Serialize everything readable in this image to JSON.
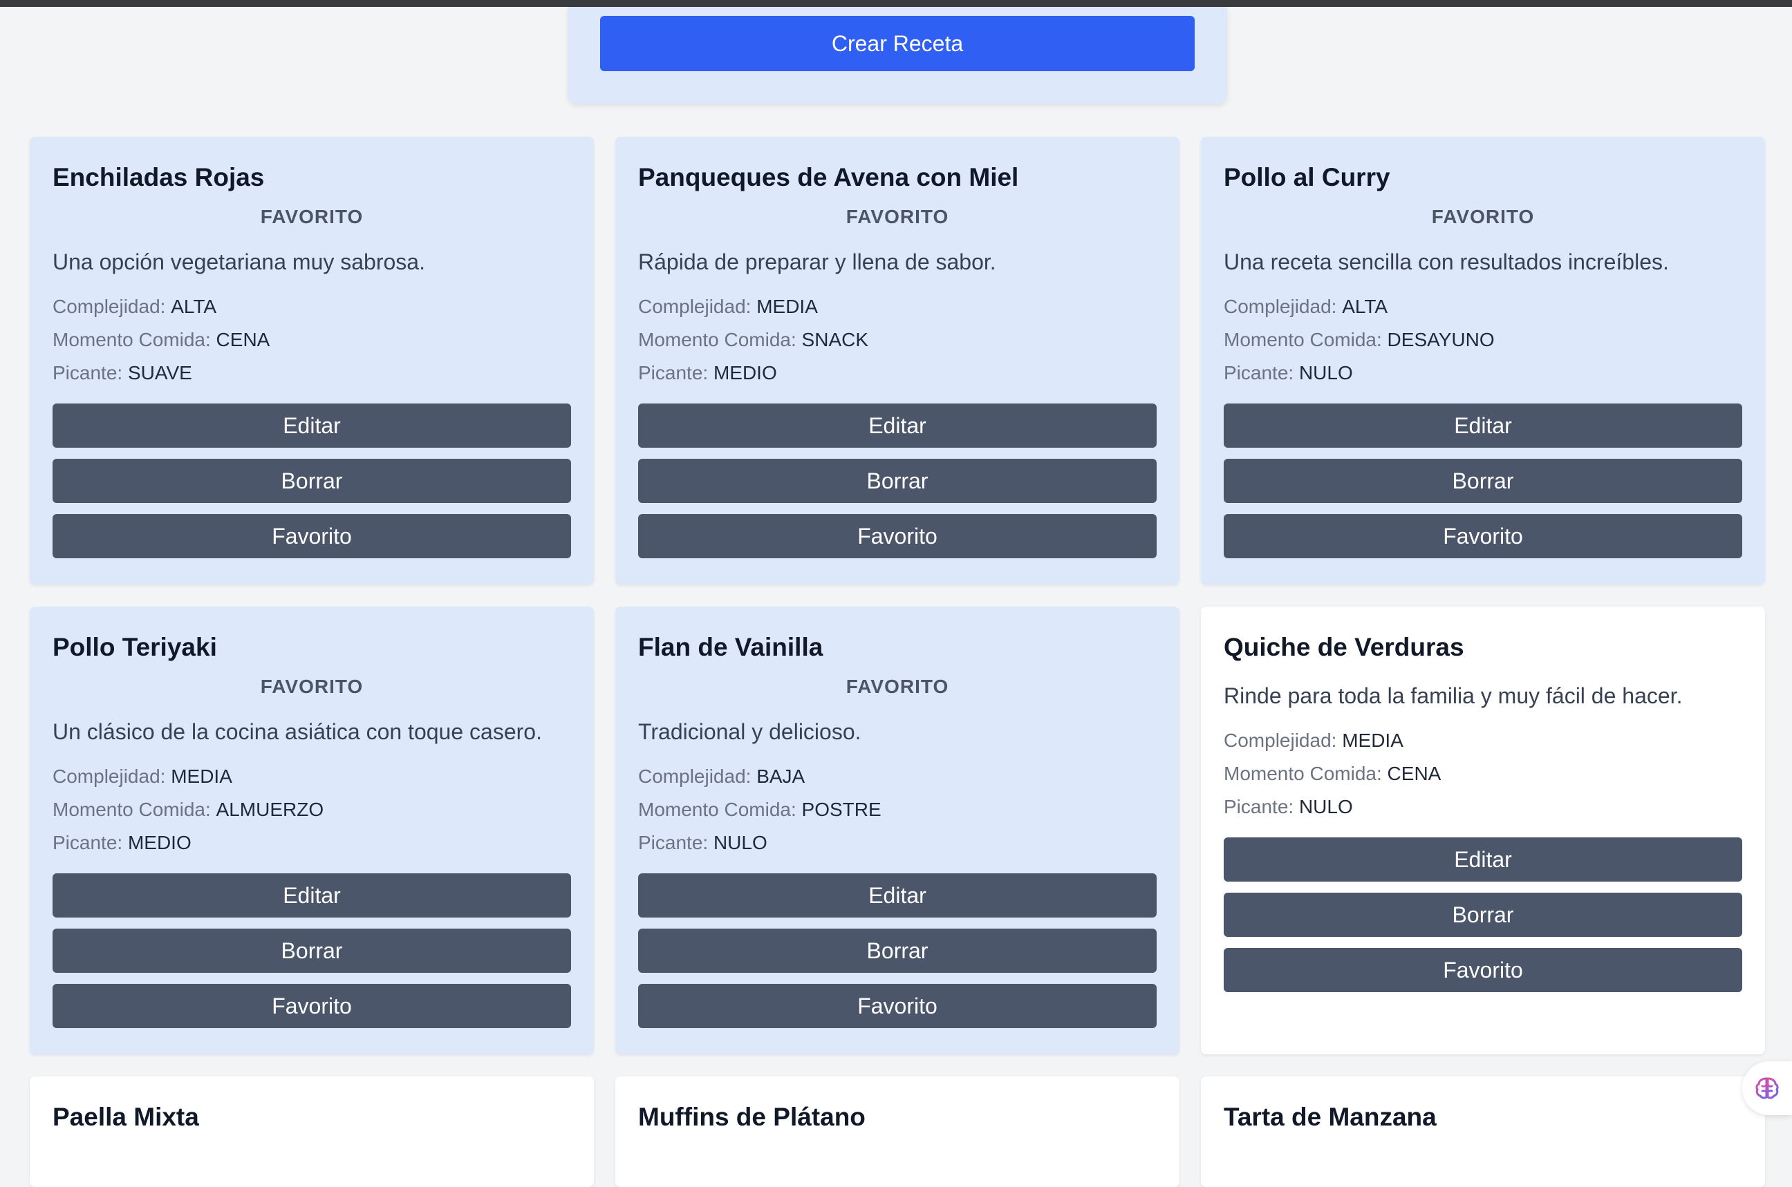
{
  "create_button": "Crear Receta",
  "favorite_badge": "FAVORITO",
  "labels": {
    "complexity": "Complejidad:",
    "meal_time": "Momento Comida:",
    "spicy": "Picante:"
  },
  "actions": {
    "edit": "Editar",
    "delete": "Borrar",
    "favorite": "Favorito"
  },
  "recipes": [
    {
      "title": "Enchiladas Rojas",
      "favorite": true,
      "description": "Una opción vegetariana muy sabrosa.",
      "complexity": "ALTA",
      "meal_time": "CENA",
      "spicy": "SUAVE"
    },
    {
      "title": "Panqueques de Avena con Miel",
      "favorite": true,
      "description": "Rápida de preparar y llena de sabor.",
      "complexity": "MEDIA",
      "meal_time": "SNACK",
      "spicy": "MEDIO"
    },
    {
      "title": "Pollo al Curry",
      "favorite": true,
      "description": "Una receta sencilla con resultados increíbles.",
      "complexity": "ALTA",
      "meal_time": "DESAYUNO",
      "spicy": "NULO"
    },
    {
      "title": "Pollo Teriyaki",
      "favorite": true,
      "description": "Un clásico de la cocina asiática con toque casero.",
      "complexity": "MEDIA",
      "meal_time": "ALMUERZO",
      "spicy": "MEDIO"
    },
    {
      "title": "Flan de Vainilla",
      "favorite": true,
      "description": "Tradicional y delicioso.",
      "complexity": "BAJA",
      "meal_time": "POSTRE",
      "spicy": "NULO"
    },
    {
      "title": "Quiche de Verduras",
      "favorite": false,
      "description": "Rinde para toda la familia y muy fácil de hacer.",
      "complexity": "MEDIA",
      "meal_time": "CENA",
      "spicy": "NULO"
    },
    {
      "title": "Paella Mixta",
      "favorite": false,
      "partial": true
    },
    {
      "title": "Muffins de Plátano",
      "favorite": false,
      "partial": true
    },
    {
      "title": "Tarta de Manzana",
      "favorite": false,
      "partial": true
    }
  ],
  "icons": {
    "floating": "brain-icon"
  },
  "colors": {
    "primary": "#2f5ff3",
    "favorite_card": "#dde8fa",
    "plain_card": "#ffffff",
    "action_button": "#4b566a"
  }
}
